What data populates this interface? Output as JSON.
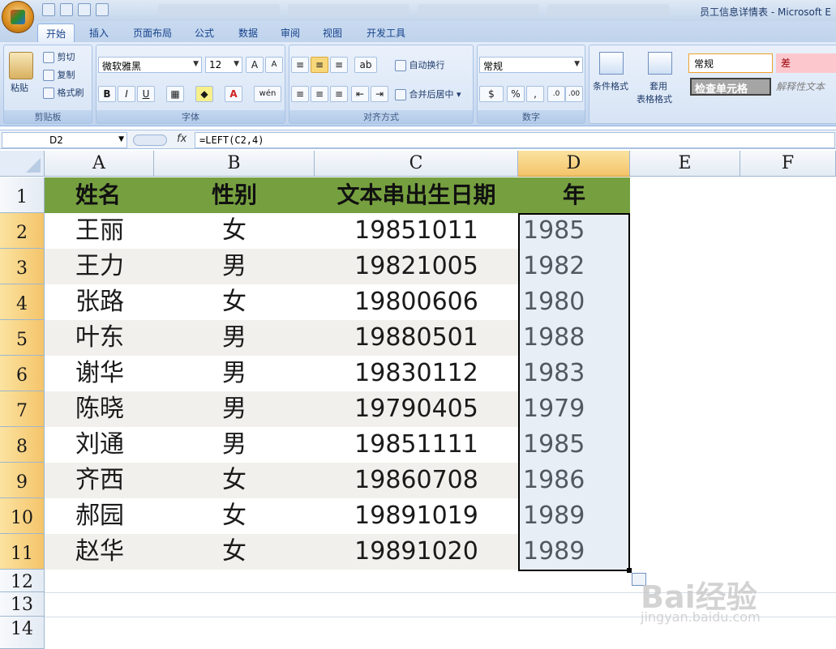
{
  "window": {
    "title": "员工信息详情表 - Microsoft E"
  },
  "tabs": [
    "开始",
    "插入",
    "页面布局",
    "公式",
    "数据",
    "审阅",
    "视图",
    "开发工具"
  ],
  "ribbon": {
    "clipboard": {
      "paste": "粘贴",
      "cut": "剪切",
      "copy": "复制",
      "format_painter": "格式刷",
      "label": "剪贴板"
    },
    "font": {
      "name": "微软雅黑",
      "size": "12",
      "bold": "B",
      "italic": "I",
      "underline": "U",
      "label": "字体",
      "phonetic": "wén"
    },
    "alignment": {
      "wrap_text": "自动换行",
      "merge_center": "合并后居中",
      "label": "对齐方式"
    },
    "number": {
      "format": "常规",
      "percent": "%",
      "comma": ",",
      "label": "数字"
    },
    "styles": {
      "conditional": "条件格式",
      "table_format_1": "套用",
      "table_format_2": "表格格式",
      "normal": "常规",
      "bad": "差",
      "check_cell": "检查单元格",
      "explanatory": "解释性文本"
    }
  },
  "formula_bar": {
    "name_box": "D2",
    "fx": "fx",
    "formula": "=LEFT(C2,4)"
  },
  "columns": [
    "A",
    "B",
    "C",
    "D",
    "E",
    "F"
  ],
  "rows": [
    "1",
    "2",
    "3",
    "4",
    "5",
    "6",
    "7",
    "8",
    "9",
    "10",
    "11",
    "12",
    "13",
    "14"
  ],
  "table": {
    "headers": [
      "姓名",
      "性别",
      "文本串出生日期",
      "年"
    ],
    "rows": [
      [
        "王丽",
        "女",
        "19851011",
        "1985"
      ],
      [
        "王力",
        "男",
        "19821005",
        "1982"
      ],
      [
        "张路",
        "女",
        "19800606",
        "1980"
      ],
      [
        "叶东",
        "男",
        "19880501",
        "1988"
      ],
      [
        "谢华",
        "男",
        "19830112",
        "1983"
      ],
      [
        "陈晓",
        "男",
        "19790405",
        "1979"
      ],
      [
        "刘通",
        "男",
        "19851111",
        "1985"
      ],
      [
        "齐西",
        "女",
        "19860708",
        "1986"
      ],
      [
        "郝园",
        "女",
        "19891019",
        "1989"
      ],
      [
        "赵华",
        "女",
        "19891020",
        "1989"
      ]
    ]
  },
  "watermark": {
    "brand": "Bai经验",
    "url": "jingyan.baidu.com"
  },
  "colors": {
    "header_fill": "#76a040",
    "band_fill": "#f2f0ec",
    "selection_header": "#f4c46a"
  }
}
